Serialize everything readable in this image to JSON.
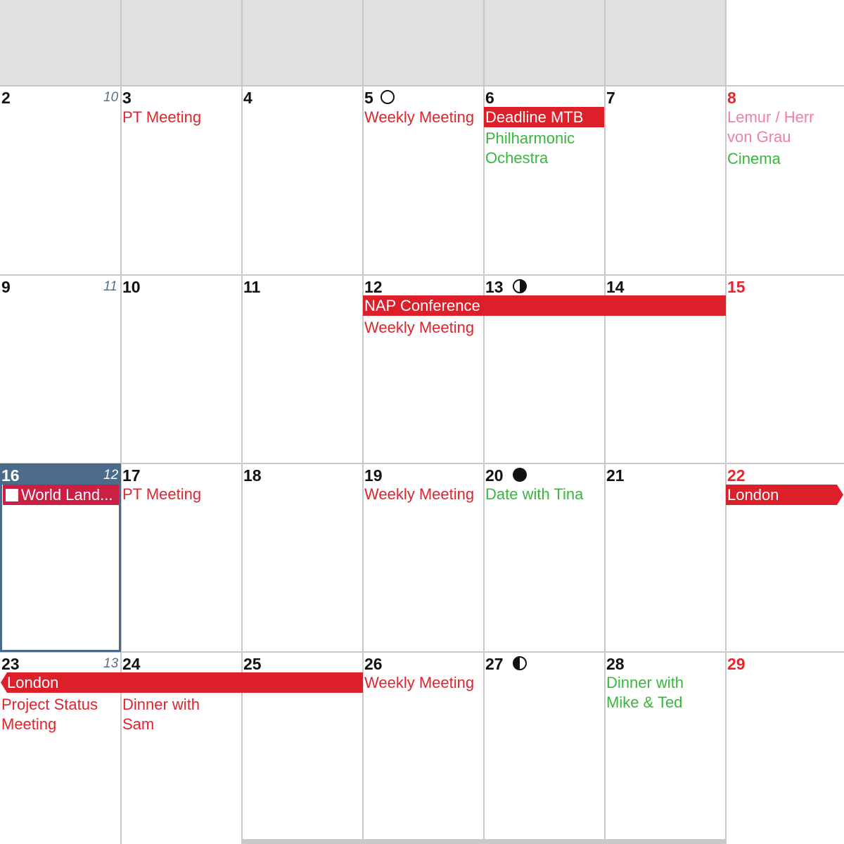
{
  "calendar": {
    "weeks": [
      {
        "week_no": "10",
        "days": [
          {
            "num": "2"
          },
          {
            "num": "3",
            "events": [
              {
                "text": "PT Meeting"
              }
            ]
          },
          {
            "num": "4"
          },
          {
            "num": "5",
            "events": [
              {
                "text": "Weekly Meeting"
              }
            ]
          },
          {
            "num": "6",
            "events": [
              {
                "text": "Deadline MTB"
              },
              {
                "text": "Philharmonic Ochestra"
              }
            ]
          },
          {
            "num": "7"
          },
          {
            "num": "8",
            "events": [
              {
                "text": "Lemur / Herr von Grau"
              },
              {
                "text": "Cinema"
              }
            ]
          }
        ]
      },
      {
        "week_no": "11",
        "days": [
          {
            "num": "9"
          },
          {
            "num": "10"
          },
          {
            "num": "11"
          },
          {
            "num": "12",
            "events": [
              {
                "text": "Weekly Meeting"
              }
            ]
          },
          {
            "num": "13"
          },
          {
            "num": "14"
          },
          {
            "num": "15"
          }
        ],
        "span_event": "NAP Conference"
      },
      {
        "week_no": "12",
        "days": [
          {
            "num": "16",
            "events": [
              {
                "text": "World Land..."
              }
            ]
          },
          {
            "num": "17",
            "events": [
              {
                "text": "PT Meeting"
              }
            ]
          },
          {
            "num": "18"
          },
          {
            "num": "19",
            "events": [
              {
                "text": "Weekly Meeting"
              }
            ]
          },
          {
            "num": "20",
            "events": [
              {
                "text": "Date with Tina"
              }
            ]
          },
          {
            "num": "21"
          },
          {
            "num": "22",
            "events": [
              {
                "text": "London"
              }
            ]
          }
        ]
      },
      {
        "week_no": "13",
        "days": [
          {
            "num": "23",
            "events": [
              {
                "text": "Project Status Meeting"
              }
            ]
          },
          {
            "num": "24",
            "events": [
              {
                "text": "Dinner with Sam"
              }
            ]
          },
          {
            "num": "25"
          },
          {
            "num": "26",
            "events": [
              {
                "text": "Weekly Meeting"
              }
            ]
          },
          {
            "num": "27"
          },
          {
            "num": "28",
            "events": [
              {
                "text": "Dinner with Mike & Ted"
              }
            ]
          },
          {
            "num": "29"
          }
        ],
        "span_event": "London"
      }
    ],
    "moon_phases": [
      "new-moon-icon",
      "first-quarter-icon",
      "full-moon-icon",
      "last-quarter-icon"
    ],
    "colors": {
      "event_red": "#e0242d",
      "event_green": "#38b73d",
      "event_pink": "#f27ea0",
      "weekend_red": "#e8252f",
      "today_blue": "#4a6c8a",
      "bar_red": "#dd1f29",
      "holiday_crimson": "#cc1f44",
      "previous_week_gray": "#e0e0e0"
    }
  }
}
